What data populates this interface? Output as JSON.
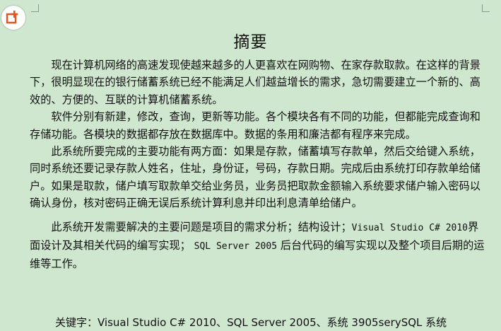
{
  "toolbar": {
    "add_icon": "add-document-icon",
    "accent_color": "#e8541f"
  },
  "document": {
    "title": "摘要",
    "paragraphs": [
      "现在计算机网络的高速发现使越来越多的人更喜欢在网购物、在家存款取款。在这样的背景下，很明显现在的银行储蓄系统已经不能满足人们越益增长的需求，急切需要建立一个新的、高效的、方便的、互联的计算机储蓄系统。",
      "软件分别有新建，修改，查询，更新等功能。各个模块各有不同的功能，但都能完成查询和存储功能。各模块的数据都存放在数据库中。数据的条用和廉洁都有程序来完成。",
      "此系统所要完成的主要功能有两方面：如果是存款，储蓄填写存款单，然后交给键入系统，同时系统还要记录存款人姓名，住址，身份证，号码，存款日期。完成后由系统打印存款单给储户。如果是取款，储户填写取款单交给业务员，业务员把取款金额输入系统要求储户输入密码以确认身份，核对密码正确无误后系统计算利息并印出利息清单给储户。"
    ],
    "paragraph4": {
      "part1": "此系统开发需要解决的主要问题是项目的需求分析；结构设计；",
      "code1": "Visual Studio C# 2010",
      "part2": "界面设计及其相关代码的编写实现；",
      "code2": "SQL Server 2005",
      "part3": "后台代码的编写实现以及整个项目后期的运维等工作。"
    },
    "keywords_line": "关键字：Visual Studio C# 2010、SQL Server 2005、系统  3905serySQL 系统"
  }
}
